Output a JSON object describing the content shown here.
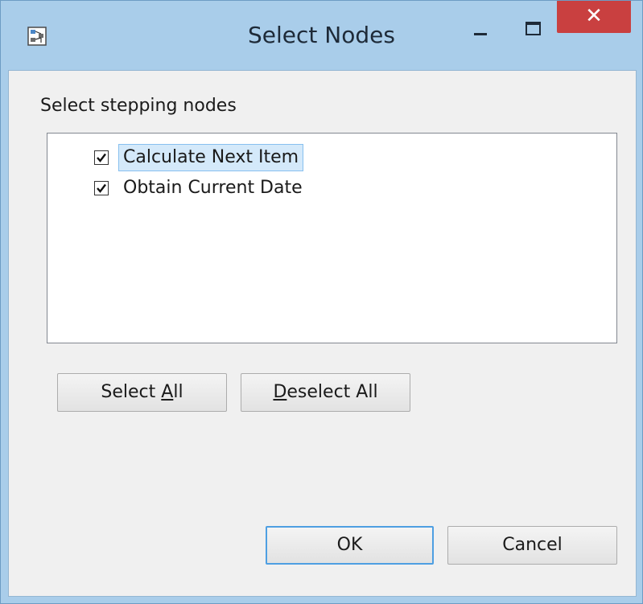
{
  "window": {
    "title": "Select Nodes",
    "close_glyph": "✕",
    "accent": "#a9cdea",
    "close_color": "#c94040"
  },
  "prompt": "Select stepping nodes",
  "nodes": [
    {
      "label": "Calculate Next Item",
      "checked": true,
      "selected": true
    },
    {
      "label": "Obtain Current Date",
      "checked": true,
      "selected": false
    }
  ],
  "buttons": {
    "select_all": {
      "pre": "Select ",
      "mnemonic": "A",
      "post": "ll"
    },
    "deselect_all": {
      "pre": "",
      "mnemonic": "D",
      "post": "eselect All"
    },
    "ok": "OK",
    "cancel": "Cancel"
  },
  "icons": {
    "app": "node-tree-icon",
    "minimize": "minimize-icon",
    "maximize": "maximize-icon",
    "close": "close-icon",
    "check": "checkmark-icon"
  }
}
